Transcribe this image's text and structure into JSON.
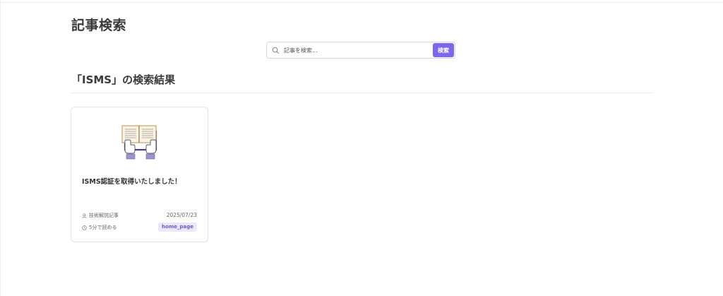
{
  "page": {
    "title": "記事検索"
  },
  "search": {
    "placeholder": "記事を検索...",
    "button_label": "検索",
    "icon": "search-icon"
  },
  "results": {
    "title": "「ISMS」の検索結果",
    "items": [
      {
        "title": "ISMS認証を取得いたしました！",
        "category": "技術解説記事",
        "date": "2025/07/23",
        "read_time": "5分で読める",
        "tag": "home_page",
        "thumbnail_icon": "open-book-hands-icon"
      }
    ]
  },
  "colors": {
    "accent": "#7b68ee",
    "tag_bg": "#ebe8fc",
    "tag_text": "#6b5ad8"
  }
}
